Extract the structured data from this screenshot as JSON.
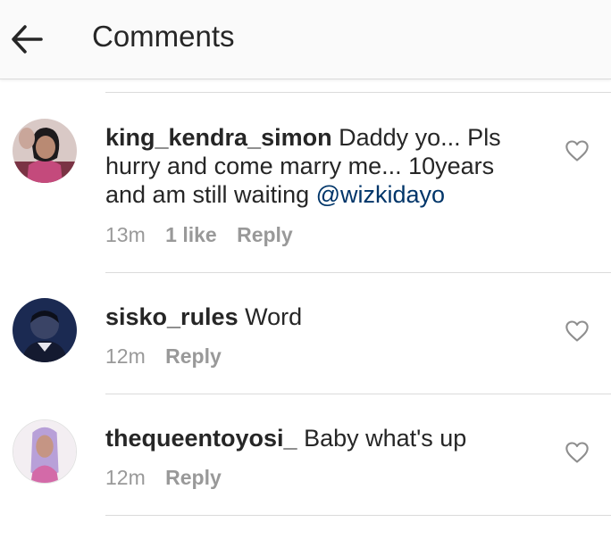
{
  "header": {
    "title": "Comments",
    "back_icon": "arrow-left-icon"
  },
  "colors": {
    "text": "#262626",
    "muted": "#999999",
    "mention": "#003569",
    "divider": "#dbdbdb"
  },
  "comments": [
    {
      "username": "king_kendra_simon",
      "text": "Daddy yo... Pls hurry and come marry me... 10years and am still waiting ",
      "mention": "@wizkidayo",
      "time": "13m",
      "likes": "1 like",
      "reply": "Reply"
    },
    {
      "username": "sisko_rules",
      "text": "Word",
      "time": "12m",
      "reply": "Reply"
    },
    {
      "username": "thequeentoyosi_",
      "text": "Baby what's up",
      "time": "12m",
      "reply": "Reply"
    }
  ]
}
